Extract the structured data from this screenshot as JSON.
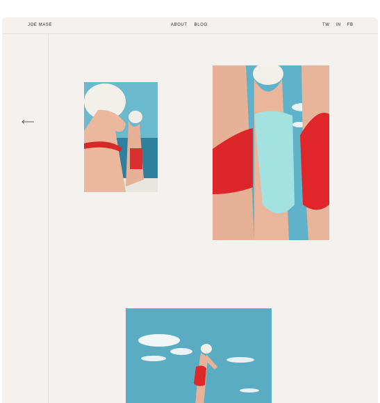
{
  "header": {
    "brand": "JOE MASE",
    "nav": [
      {
        "label": "ABOUT"
      },
      {
        "label": "BLOG"
      }
    ],
    "social": [
      {
        "label": "TW"
      },
      {
        "label": "IN"
      },
      {
        "label": "FB"
      }
    ]
  },
  "icons": {
    "back": "arrow-left-icon"
  },
  "gallery": [
    {
      "name": "swimmers-in-caps-photo"
    },
    {
      "name": "three-swimsuits-photo"
    },
    {
      "name": "swimmer-under-sky-photo"
    }
  ],
  "colors": {
    "background": "#f5f1ee",
    "sky": "#5fb0c4",
    "swimsuit_red": "#e02a2a",
    "swimsuit_aqua": "#9fe0df",
    "skin": "#e8b59a",
    "cap": "#f2efe9",
    "text": "#2b2b2b"
  }
}
